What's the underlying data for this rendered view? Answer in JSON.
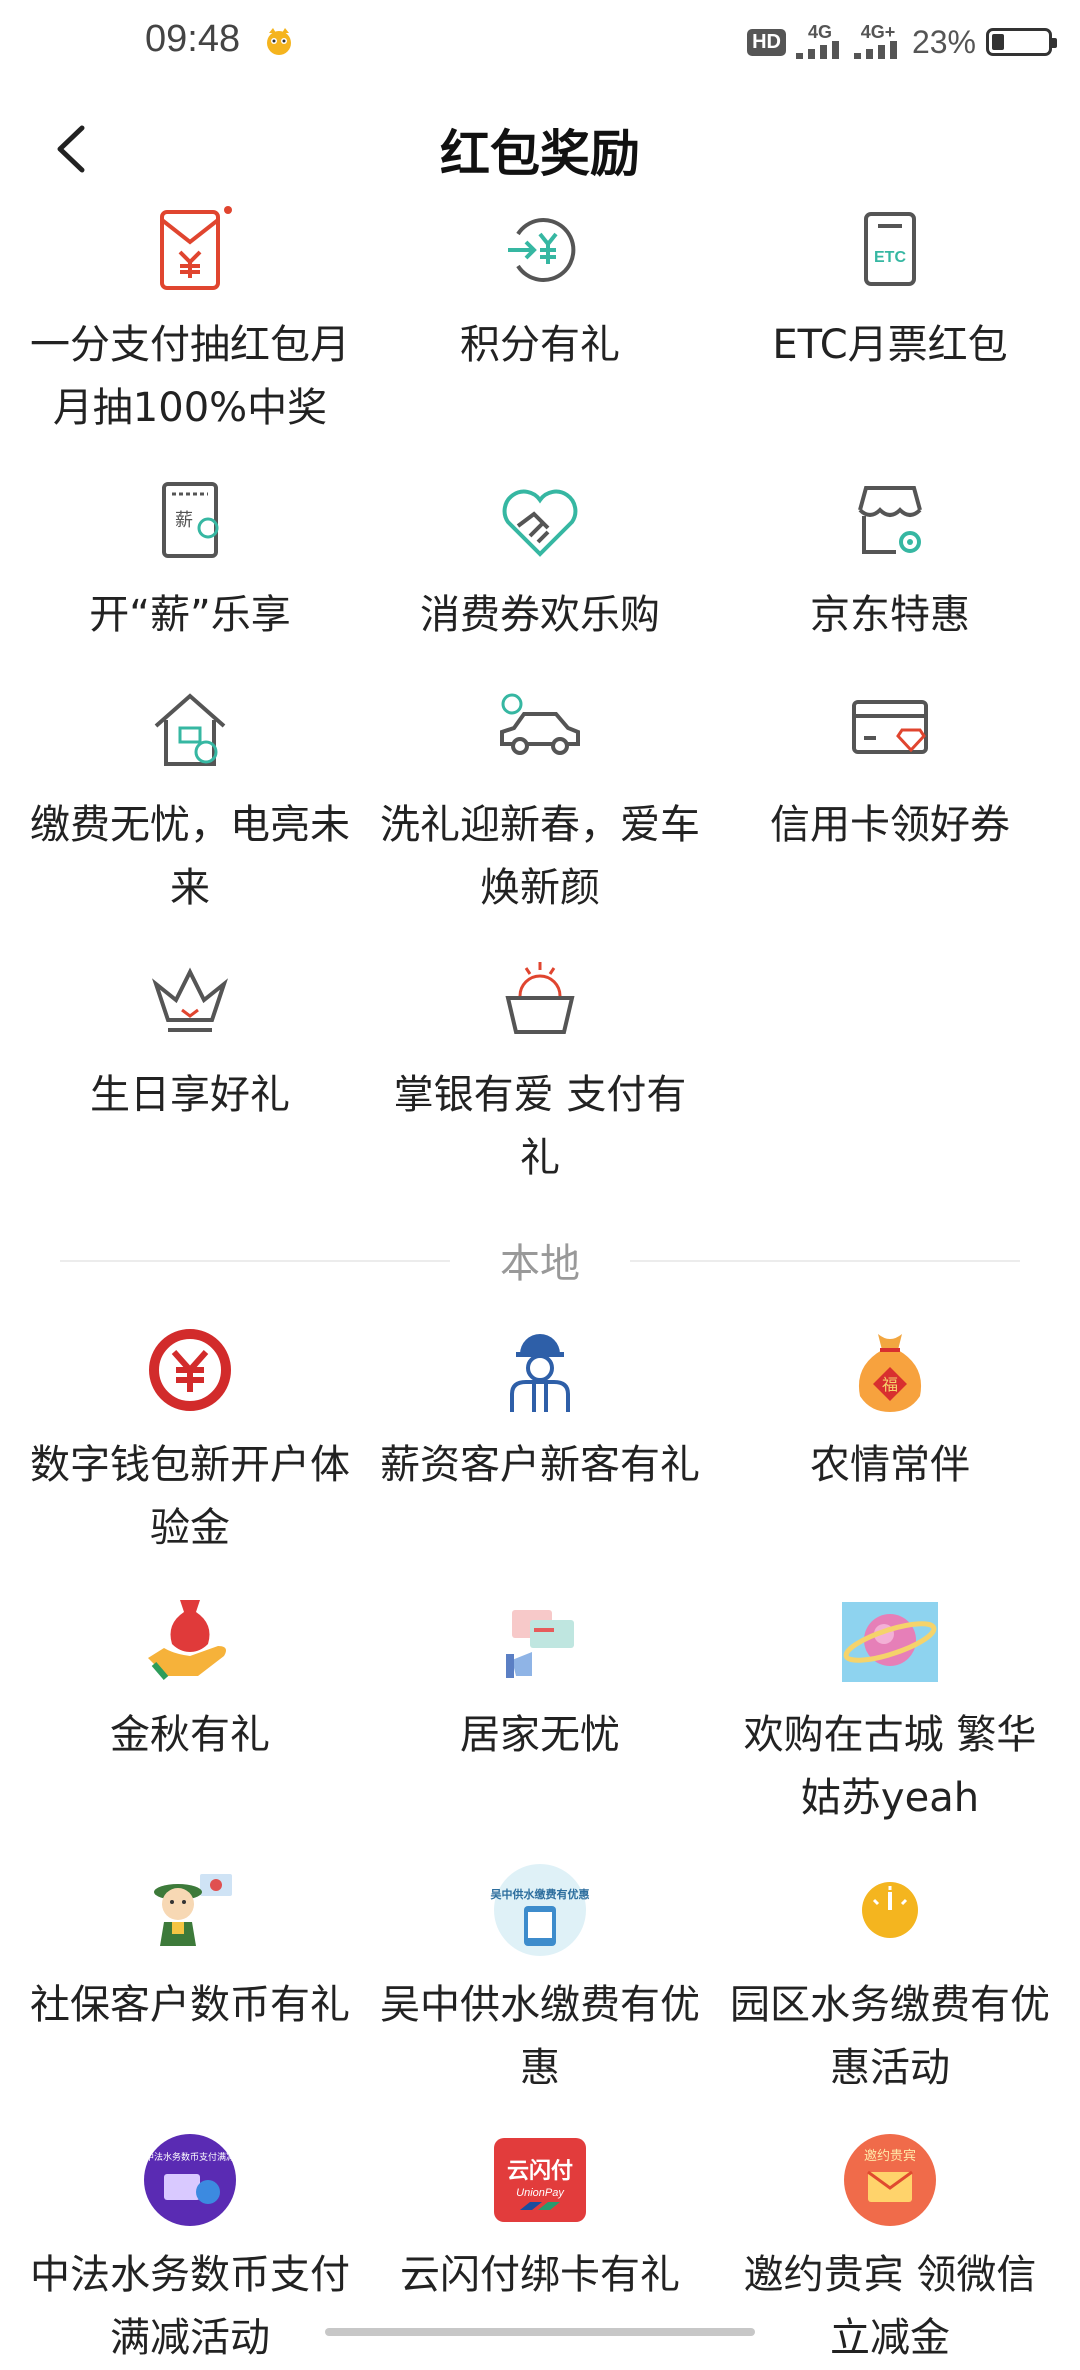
{
  "status": {
    "time": "09:48",
    "hd": "HD",
    "net1": "4G",
    "net2": "4G+",
    "battery_text": "23%",
    "battery_level": 0.23
  },
  "header": {
    "title": "红包奖励"
  },
  "section_local": "本地",
  "items_top": [
    {
      "label": "一分支付抽红包月月抽100%中奖",
      "icon": "red-envelope-icon"
    },
    {
      "label": "积分有礼",
      "icon": "points-exchange-icon"
    },
    {
      "label": "ETC月票红包",
      "icon": "etc-card-icon"
    },
    {
      "label": "开“薪”乐享",
      "icon": "salary-doc-icon"
    },
    {
      "label": "消费券欢乐购",
      "icon": "handshake-heart-icon"
    },
    {
      "label": "京东特惠",
      "icon": "store-gear-icon"
    },
    {
      "label": "缴费无忧，电亮未来",
      "icon": "house-payment-icon"
    },
    {
      "label": "洗礼迎新春，爱车焕新颜",
      "icon": "car-wash-icon"
    },
    {
      "label": "信用卡领好券",
      "icon": "credit-card-diamond-icon"
    },
    {
      "label": "生日享好礼",
      "icon": "crown-icon"
    },
    {
      "label": "掌银有爱 支付有礼",
      "icon": "gift-basket-icon"
    }
  ],
  "items_local": [
    {
      "label": "数字钱包新开户体验金",
      "icon": "digital-yuan-icon"
    },
    {
      "label": "薪资客户新客有礼",
      "icon": "worker-icon"
    },
    {
      "label": "农情常伴",
      "icon": "fortune-bag-icon"
    },
    {
      "label": "金秋有礼",
      "icon": "hand-money-bag-icon"
    },
    {
      "label": "居家无忧",
      "icon": "home-card-illustration-icon"
    },
    {
      "label": "欢购在古城 繁华姑苏yeah",
      "icon": "planet-illustration-icon"
    },
    {
      "label": "社保客户数币有礼",
      "icon": "cartoon-mascot-icon"
    },
    {
      "label": "吴中供水缴费有优惠",
      "icon": "water-payment-badge-icon"
    },
    {
      "label": "园区水务缴费有优惠活动",
      "icon": "gauge-icon"
    },
    {
      "label": "中法水务数币支付满减活动",
      "icon": "water-digital-badge-icon"
    },
    {
      "label": "云闪付绑卡有礼",
      "icon": "unionpay-icon"
    },
    {
      "label": "邀约贵宾 领微信立减金",
      "icon": "invite-vip-badge-icon"
    }
  ],
  "badge_texts": {
    "fu": "福",
    "etc": "ETC",
    "xin": "薪",
    "yunshanfu": "云闪付",
    "unionpay": "UnionPay",
    "wuzhong": "吴中供水缴费有优惠",
    "zhongfa": "江苏中法水务数币支付满减活动",
    "yaoyue": "邀约贵宾"
  },
  "colors": {
    "red": "#e0452f",
    "teal": "#36b7a2",
    "gray_icon": "#555555",
    "blue": "#2e5fa8"
  }
}
